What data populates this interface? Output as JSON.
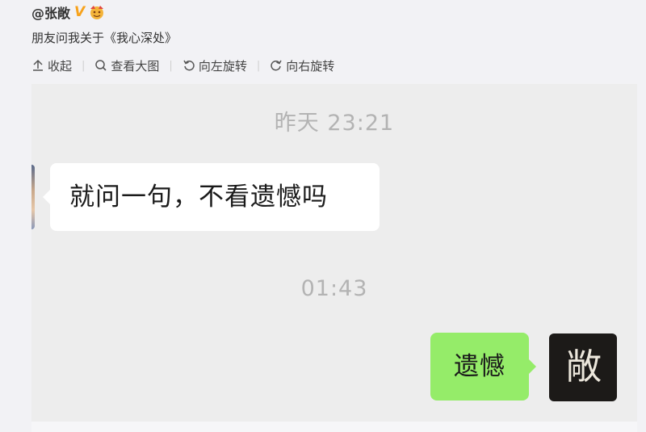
{
  "post": {
    "author": "@张敞",
    "verified_badge": "V",
    "text": "朋友问我关于《我心深处》"
  },
  "toolbar": {
    "collapse_label": "收起",
    "view_large_label": "查看大图",
    "rotate_left_label": "向左旋转",
    "rotate_right_label": "向右旋转"
  },
  "chat": {
    "time_1": "昨天 23:21",
    "message_in": "就问一句，不看遗憾吗",
    "time_2": "01:43",
    "message_out": "遗憾",
    "avatar_glyph": "敞"
  },
  "colors": {
    "badge": "#f7a21b",
    "bubble_out": "#95ec69",
    "bubble_in": "#ffffff",
    "chat_bg": "#ededed",
    "timestamp": "#b3b3b3"
  }
}
